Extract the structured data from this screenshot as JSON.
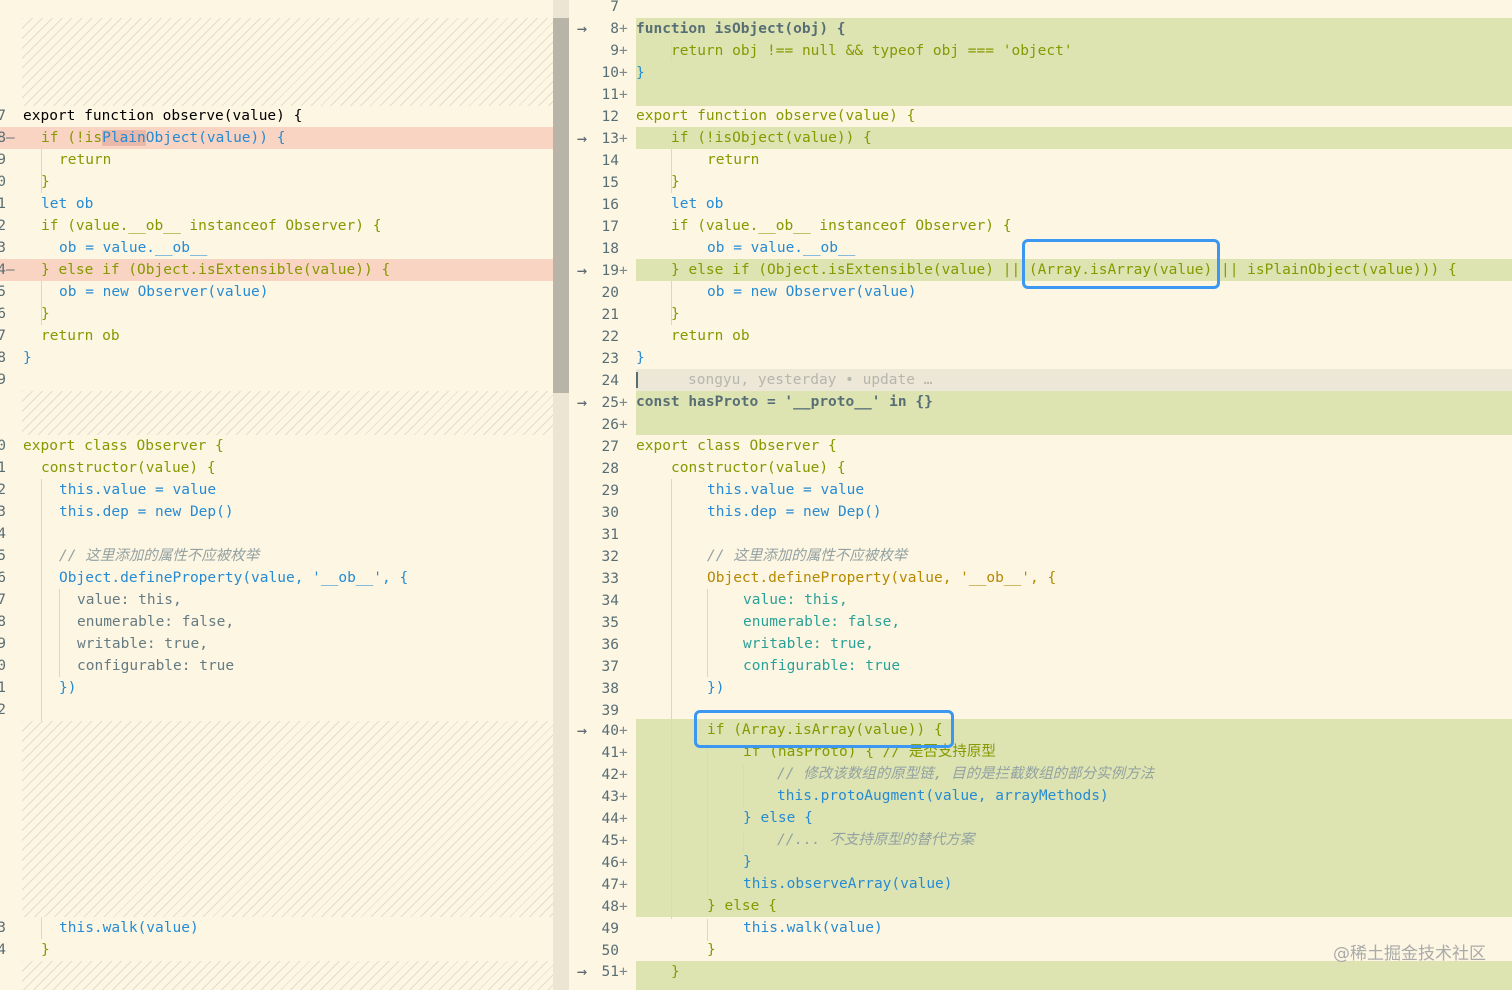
{
  "left": {
    "line_numbers": [
      "7",
      "8",
      "9",
      "0",
      "1",
      "2",
      "3",
      "4",
      "5",
      "6",
      "7",
      "8",
      "9",
      "0",
      "1",
      "2",
      "3",
      "4",
      "5",
      "6",
      "7",
      "8",
      "9",
      "0",
      "1",
      "2",
      "3",
      "4"
    ],
    "del_sign": "—",
    "lines": {
      "l7": "export function observe(value) {",
      "l8_a": "if (!is",
      "l8_hl": "Plain",
      "l8_b": "Object(value)) {",
      "l9": "return",
      "l10": "}",
      "l11": "let ob",
      "l12": "if (value.__ob__ instanceof Observer) {",
      "l13": "ob = value.__ob__",
      "l14": "} else if (Object.isExtensible(value)) {",
      "l15": "ob = new Observer(value)",
      "l16": "}",
      "l17": "return ob",
      "l18": "}",
      "l20": "export class Observer {",
      "l21": "constructor(value) {",
      "l22": "this.value = value",
      "l23": "this.dep = new Dep()",
      "l25": "// 这里添加的属性不应被枚举",
      "l26": "Object.defineProperty(value, '__ob__', {",
      "l27": "value: this,",
      "l28": "enumerable: false,",
      "l29": "writable: true,",
      "l30": "configurable: true",
      "l31": "})",
      "l33": "this.walk(value)",
      "l34": "}"
    }
  },
  "gutter": {
    "arrow": "→",
    "plus": "+",
    "numbers": [
      "7",
      "8",
      "9",
      "10",
      "11",
      "12",
      "13",
      "14",
      "15",
      "16",
      "17",
      "18",
      "19",
      "20",
      "21",
      "22",
      "23",
      "24",
      "25",
      "26",
      "27",
      "28",
      "29",
      "30",
      "31",
      "32",
      "33",
      "34",
      "35",
      "36",
      "37",
      "38",
      "39",
      "40",
      "41",
      "42",
      "43",
      "44",
      "45",
      "46",
      "47",
      "48",
      "49",
      "50",
      "51"
    ]
  },
  "right": {
    "blame_text": "songyu, yesterday • update …",
    "lines": {
      "r8": "function isObject(obj) {",
      "r9": "return obj !== null && typeof obj === 'object'",
      "r10": "}",
      "r12": "export function observe(value) {",
      "r13": "if (!isObject(value)) {",
      "r14": "return",
      "r15": "}",
      "r16": "let ob",
      "r17": "if (value.__ob__ instanceof Observer) {",
      "r18": "ob = value.__ob__",
      "r19": "} else if (Object.isExtensible(value) || (Array.isArray(value) || isPlainObject(value))) {",
      "r20": "ob = new Observer(value)",
      "r21": "}",
      "r22": "return ob",
      "r23": "}",
      "r25": "const hasProto = '__proto__' in {}",
      "r27": "export class Observer {",
      "r28": "constructor(value) {",
      "r29": "this.value = value",
      "r30": "this.dep = new Dep()",
      "r32": "// 这里添加的属性不应被枚举",
      "r33": "Object.defineProperty(value, '__ob__', {",
      "r34": "value: this,",
      "r35": "enumerable: false,",
      "r36": "writable: true,",
      "r37": "configurable: true",
      "r38": "})",
      "r40": "if (Array.isArray(value)) {",
      "r41": "if (hasProto) { // 是否支持原型",
      "r42": "// 修改该数组的原型链, 目的是拦截数组的部分实例方法",
      "r43": "this.protoAugment(value, arrayMethods)",
      "r44": "} else {",
      "r45": "//... 不支持原型的替代方案",
      "r46": "}",
      "r47": "this.observeArray(value)",
      "r48": "} else {",
      "r49": "this.walk(value)",
      "r50": "}",
      "r51": "}"
    }
  },
  "watermark": "@稀土掘金技术社区",
  "colors": {
    "background": "#fdf6e3",
    "deleted": "#f9d4c2",
    "added": "#dde4b2",
    "callout": "#3b97f2"
  }
}
